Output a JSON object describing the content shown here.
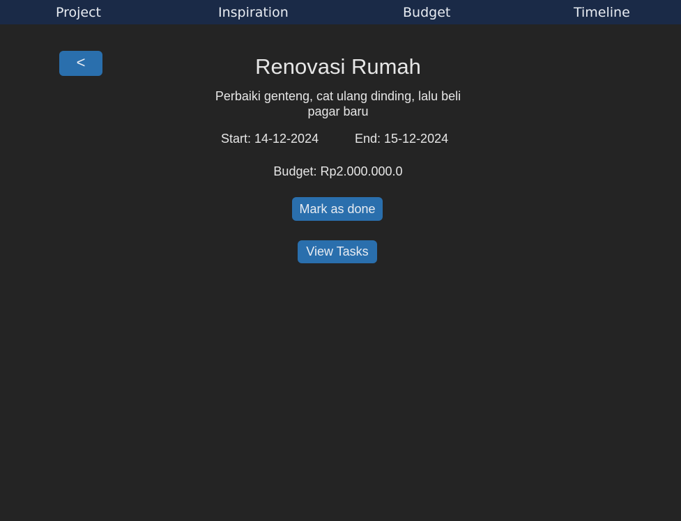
{
  "nav": {
    "items": [
      {
        "label": "Project"
      },
      {
        "label": "Inspiration"
      },
      {
        "label": "Budget"
      },
      {
        "label": "Timeline"
      }
    ]
  },
  "back_button": {
    "label": "<"
  },
  "project": {
    "title": "Renovasi Rumah",
    "description": "Perbaiki genteng, cat ulang dinding, lalu beli pagar baru",
    "start": "Start: 14-12-2024",
    "end": "End: 15-12-2024",
    "budget": "Budget: Rp2.000.000.0"
  },
  "actions": {
    "mark_done_label": "Mark as done",
    "view_tasks_label": "View Tasks"
  },
  "colors": {
    "background": "#242424",
    "nav_background": "#1a2a47",
    "button": "#2a6fad",
    "text": "#e6e6e6"
  }
}
